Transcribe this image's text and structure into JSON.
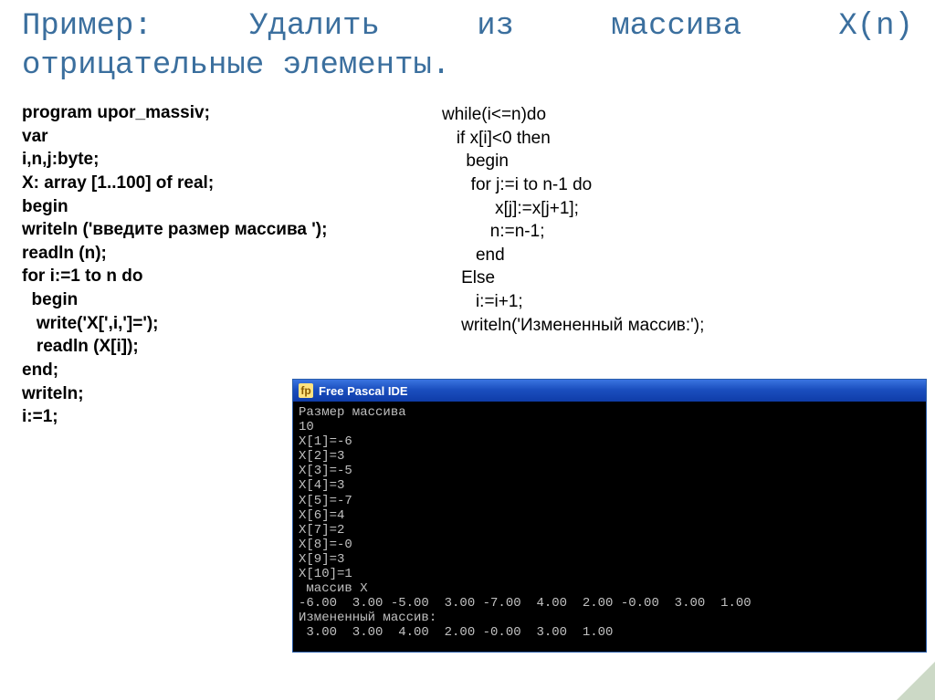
{
  "title_line1": "Пример:    Удалить    из    массива    X(n)",
  "title_line2": "отрицательные элементы.",
  "left_code": "program upor_massiv;\nvar\ni,n,j:byte;\nX: array [1..100] of real;\nbegin\nwriteln ('введите размер массива ');\nreadln (n);\nfor i:=1 to n do\n  begin\n   write('X[',i,']=');\n   readln (X[i]);\nend;\nwriteln;\ni:=1;",
  "right_code": "while(i<=n)do\n   if x[i]<0 then\n     begin\n      for j:=i to n-1 do\n           x[j]:=x[j+1];\n          n:=n-1;\n       end\n    Else\n       i:=i+1;\n    writeln('Измененный массив:');",
  "window_title": "Free Pascal IDE",
  "console_lines": [
    "Размер массива",
    "10",
    "X[1]=-6",
    "X[2]=3",
    "X[3]=-5",
    "X[4]=3",
    "X[5]=-7",
    "X[6]=4",
    "X[7]=2",
    "X[8]=-0",
    "X[9]=3",
    "X[10]=1",
    " массив X",
    "-6.00  3.00 -5.00  3.00 -7.00  4.00  2.00 -0.00  3.00  1.00",
    "Измененный массив:",
    " 3.00  3.00  4.00  2.00 -0.00  3.00  1.00"
  ]
}
